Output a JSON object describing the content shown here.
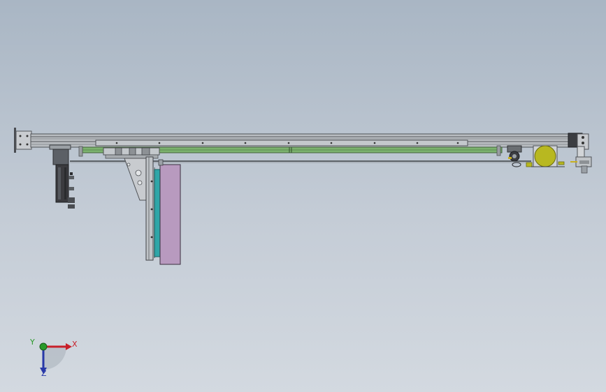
{
  "viewport": {
    "background_top": "#a9b6c4",
    "background_bottom": "#d3d9e0"
  },
  "colors": {
    "frame": "#6f7378",
    "frame_light": "#b4b8bc",
    "green_guide": "#7db36f",
    "teal_panel": "#2fa6a8",
    "purple_panel": "#b89abf",
    "motor": "#3b3b3f",
    "yellow_disc": "#b8b820"
  },
  "triad": {
    "x_label": "X",
    "y_label": "Y",
    "z_label": "Z",
    "x_color": "#c8202a",
    "y_color": "#2a9a2a",
    "z_color": "#2838a8"
  }
}
